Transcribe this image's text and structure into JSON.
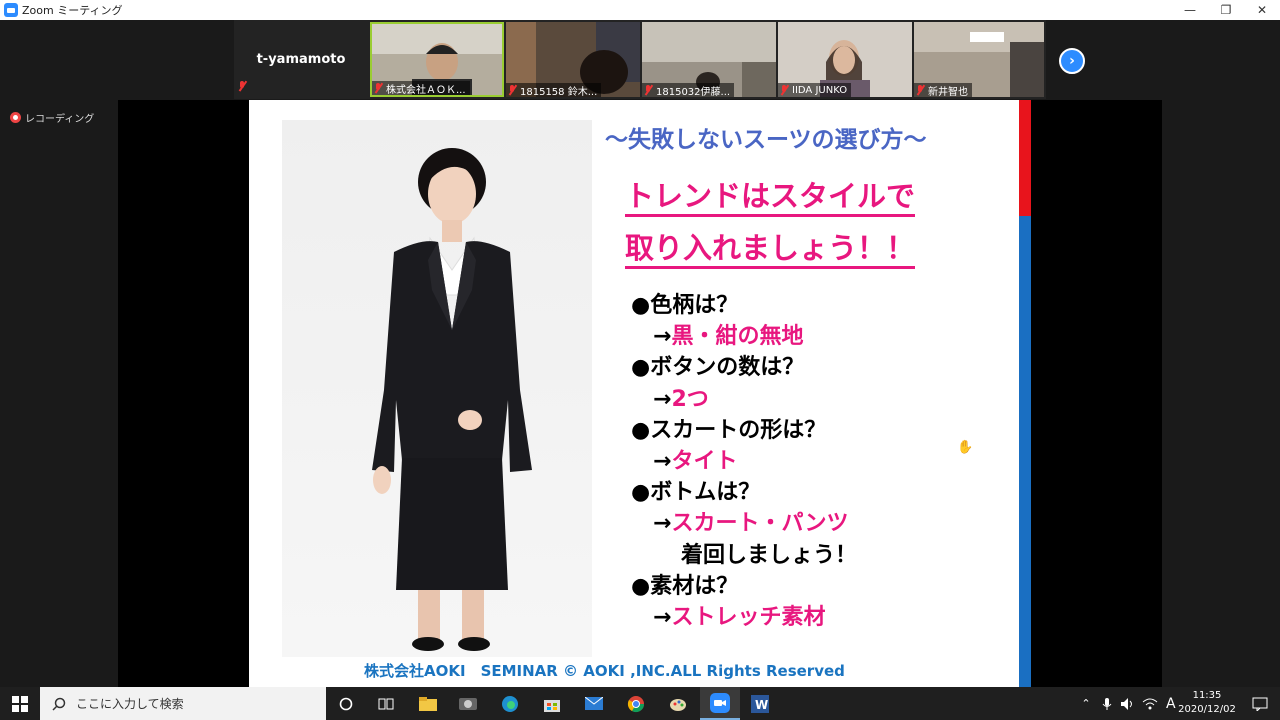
{
  "window": {
    "title": "Zoom ミーティング",
    "controls": [
      "—",
      "❐",
      "✕"
    ]
  },
  "gallery": {
    "active_speaker_name": "t-yamamoto",
    "participants": [
      {
        "label": "株式会社ＡＯＫ...",
        "bg": "#a89f8c"
      },
      {
        "label": "1815158 鈴木...",
        "bg": "#5a4a3c"
      },
      {
        "label": "1815032伊藤...",
        "bg": "#8a8478"
      },
      {
        "label": "IIDA JUNKO",
        "bg": "#c9c2b8"
      },
      {
        "label": "新井智也",
        "bg": "#b8b0a6"
      }
    ]
  },
  "recording": {
    "label": "レコーディング"
  },
  "slide": {
    "title": "〜失敗しないスーツの選び方〜",
    "headline_1": "トレンドはスタイルで",
    "headline_2": "取り入れましょう！！",
    "items": [
      {
        "question": "●色柄は？",
        "arrow": "→",
        "answer": "黒・紺の無地"
      },
      {
        "question": "●ボタンの数は？",
        "arrow": "→",
        "answer": "2つ"
      },
      {
        "question": "●スカートの形は？",
        "arrow": "→",
        "answer": "タイト"
      },
      {
        "question": "●ボトムは？",
        "arrow": "→",
        "answer": "スカート・パンツ",
        "note": "着回しましょう！"
      },
      {
        "question": "●素材は？",
        "arrow": "→",
        "answer": "ストレッチ素材"
      }
    ],
    "footer": "株式会社AOKI　SEMINAR © AOKI ,INC.ALL Rights Reserved",
    "colors": {
      "title": "#4a66c4",
      "accent": "#e8177f",
      "footer": "#1a74c0",
      "bar_red": "#e8141c",
      "bar_blue": "#1a6fc2"
    }
  },
  "taskbar": {
    "search_placeholder": "ここに入力して検索",
    "tray_ime": "A",
    "time": "11:35",
    "date": "2020/12/02"
  }
}
